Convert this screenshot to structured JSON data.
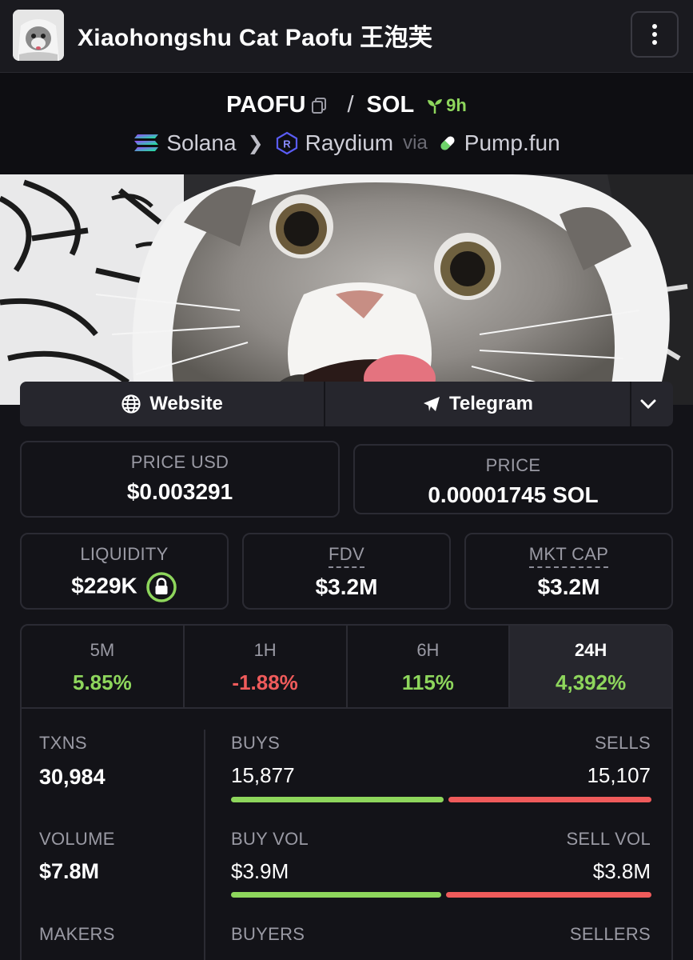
{
  "header": {
    "title": "Xiaohongshu Cat Paofu 王泡芙",
    "menu_icon": "vertical-dots-icon"
  },
  "pair": {
    "base": "PAOFU",
    "quote": "SOL",
    "separator": "/",
    "age": "9h",
    "chain": "Solana",
    "dex": "Raydium",
    "via_label": "via",
    "launchpad": "Pump.fun"
  },
  "links": {
    "website": "Website",
    "telegram": "Telegram"
  },
  "price": {
    "usd_label": "PRICE USD",
    "usd_value": "$0.003291",
    "native_label": "PRICE",
    "native_value": "0.00001745 SOL"
  },
  "metrics": {
    "liquidity_label": "LIQUIDITY",
    "liquidity_value": "$229K",
    "fdv_label": "FDV",
    "fdv_value": "$3.2M",
    "mktcap_label": "MKT CAP",
    "mktcap_value": "$3.2M"
  },
  "timeframes": [
    {
      "label": "5M",
      "value": "5.85%"
    },
    {
      "label": "1H",
      "value": "-1.88%"
    },
    {
      "label": "6H",
      "value": "115%"
    },
    {
      "label": "24H",
      "value": "4,392%"
    }
  ],
  "stats": {
    "txns_label": "TXNS",
    "txns_value": "30,984",
    "buys_label": "BUYS",
    "buys_value": "15,877",
    "sells_label": "SELLS",
    "sells_value": "15,107",
    "buys_share": 0.512,
    "volume_label": "VOLUME",
    "volume_value": "$7.8M",
    "buyvol_label": "BUY VOL",
    "buyvol_value": "$3.9M",
    "sellvol_label": "SELL VOL",
    "sellvol_value": "$3.8M",
    "buyvol_share": 0.506,
    "makers_label": "MAKERS",
    "buyers_label": "BUYERS",
    "sellers_label": "SELLERS"
  },
  "colors": {
    "positive": "#8ed65c",
    "negative": "#ef5b5b",
    "background": "#131318"
  }
}
